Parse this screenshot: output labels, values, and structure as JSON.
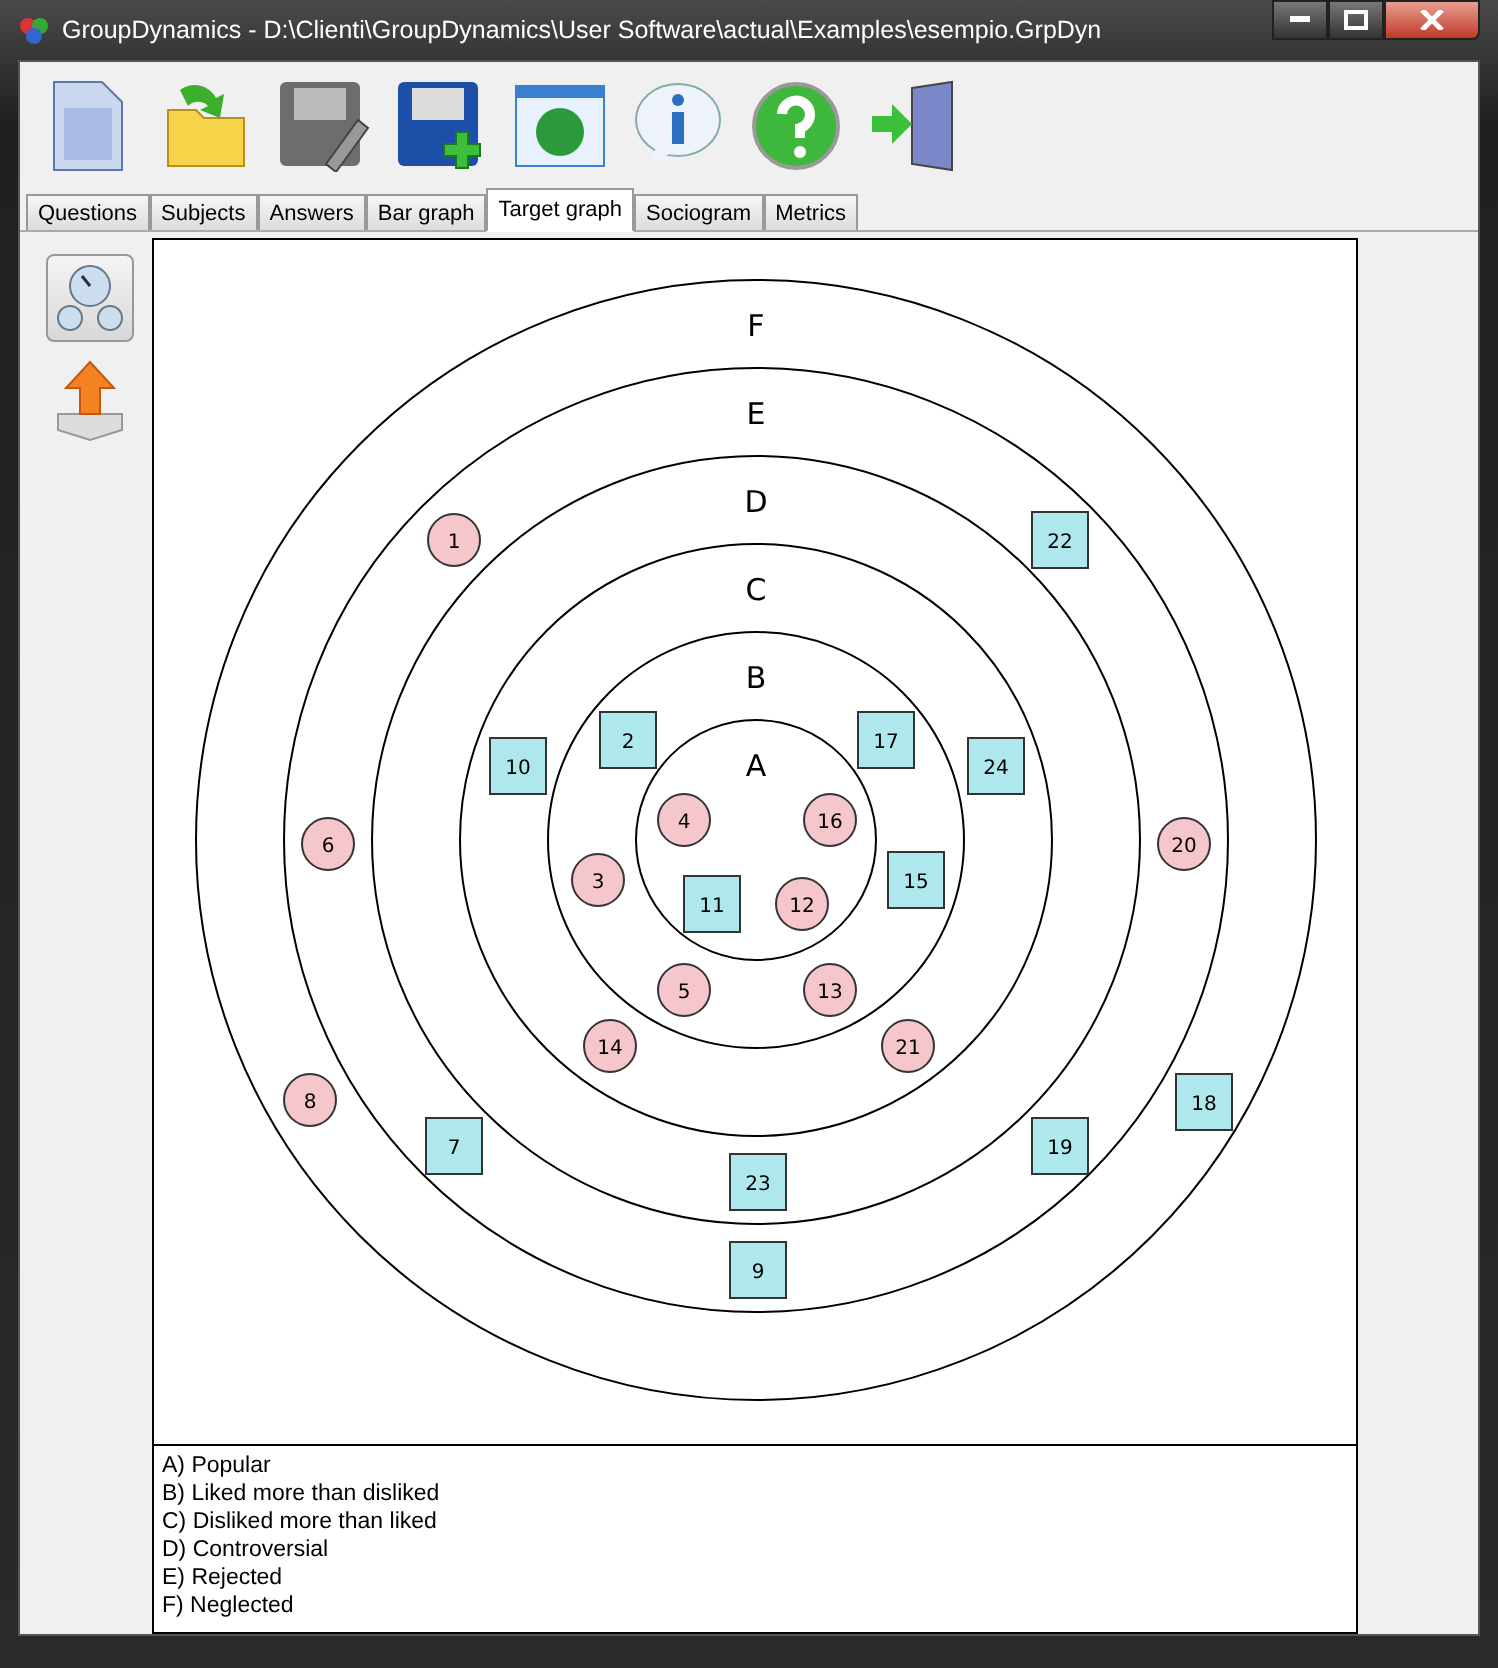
{
  "window": {
    "title": "GroupDynamics - D:\\Clienti\\GroupDynamics\\User Software\\actual\\Examples\\esempio.GrpDyn"
  },
  "tabs": [
    {
      "label": "Questions",
      "selected": false
    },
    {
      "label": "Subjects",
      "selected": false
    },
    {
      "label": "Answers",
      "selected": false
    },
    {
      "label": "Bar graph",
      "selected": false
    },
    {
      "label": "Target graph",
      "selected": true
    },
    {
      "label": "Sociogram",
      "selected": false
    },
    {
      "label": "Metrics",
      "selected": false
    }
  ],
  "rings": [
    "F",
    "E",
    "D",
    "C",
    "B",
    "A"
  ],
  "nodes": [
    {
      "label": "1",
      "kind": "circle"
    },
    {
      "label": "22",
      "kind": "square"
    },
    {
      "label": "10",
      "kind": "square"
    },
    {
      "label": "2",
      "kind": "square"
    },
    {
      "label": "17",
      "kind": "square"
    },
    {
      "label": "24",
      "kind": "square"
    },
    {
      "label": "4",
      "kind": "circle"
    },
    {
      "label": "16",
      "kind": "circle"
    },
    {
      "label": "6",
      "kind": "circle"
    },
    {
      "label": "20",
      "kind": "circle"
    },
    {
      "label": "3",
      "kind": "circle"
    },
    {
      "label": "11",
      "kind": "square"
    },
    {
      "label": "12",
      "kind": "circle"
    },
    {
      "label": "15",
      "kind": "square"
    },
    {
      "label": "5",
      "kind": "circle"
    },
    {
      "label": "13",
      "kind": "circle"
    },
    {
      "label": "14",
      "kind": "circle"
    },
    {
      "label": "21",
      "kind": "circle"
    },
    {
      "label": "8",
      "kind": "circle"
    },
    {
      "label": "18",
      "kind": "square"
    },
    {
      "label": "7",
      "kind": "square"
    },
    {
      "label": "19",
      "kind": "square"
    },
    {
      "label": "23",
      "kind": "square"
    },
    {
      "label": "9",
      "kind": "square"
    }
  ],
  "legend": [
    "A) Popular",
    "B) Liked more than disliked",
    "C) Disliked more than liked",
    "D) Controversial",
    "E) Rejected",
    "F) Neglected"
  ]
}
